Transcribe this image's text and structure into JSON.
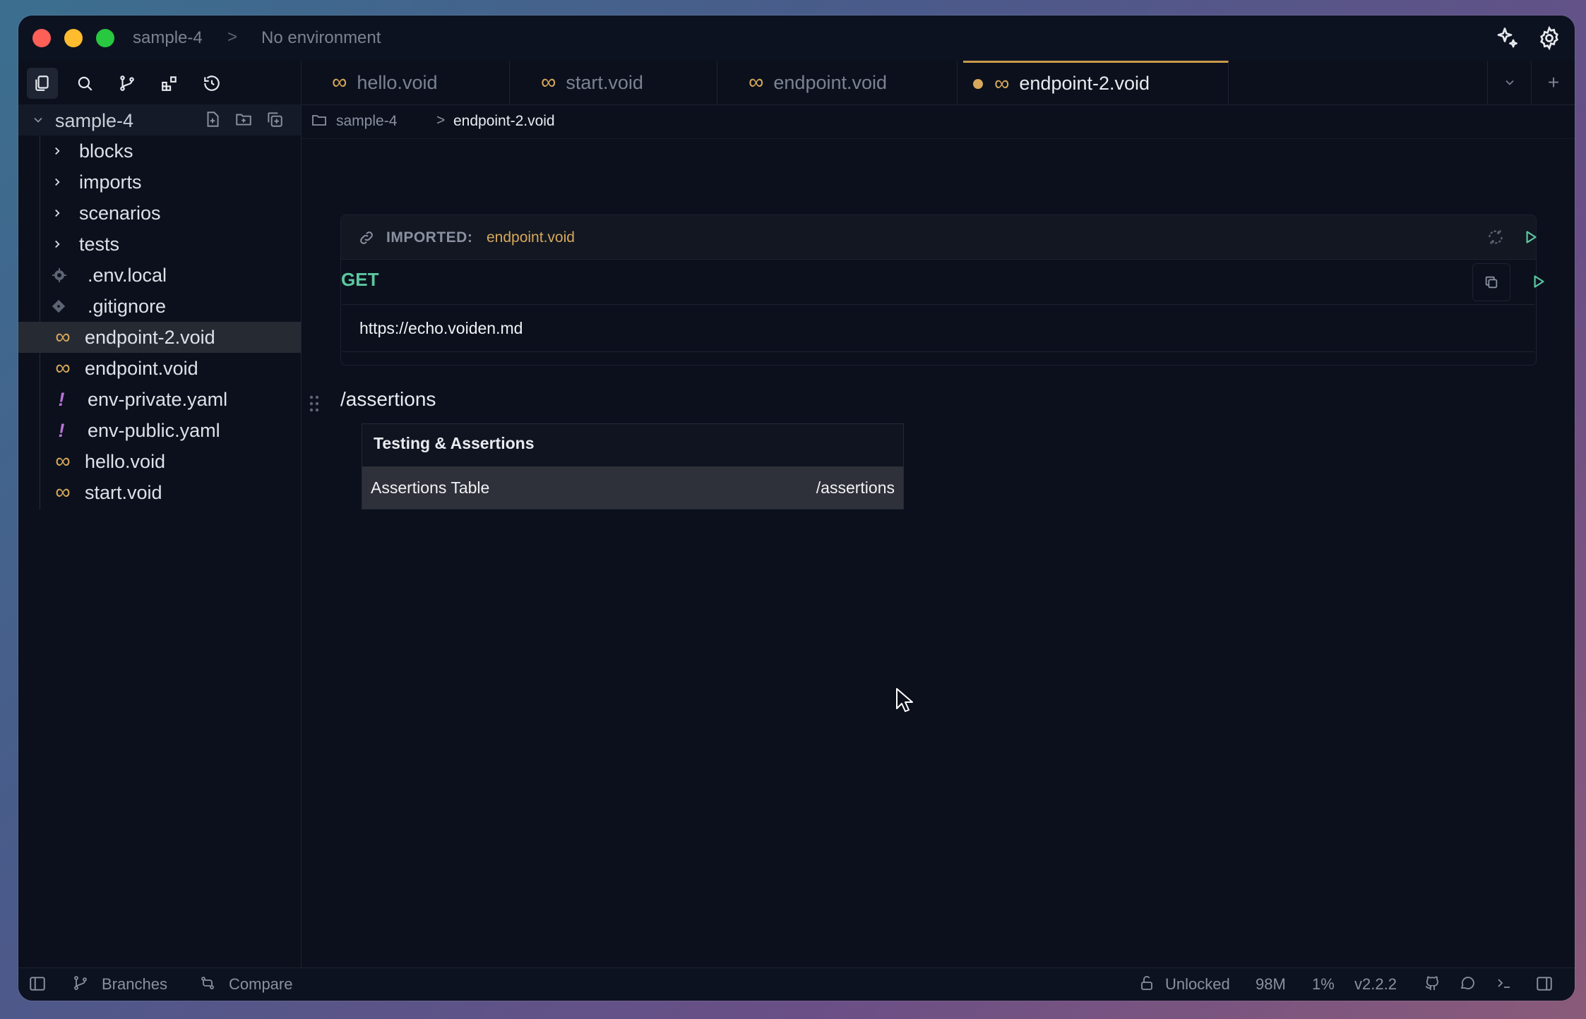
{
  "titlebar": {
    "project": "sample-4",
    "separator": ">",
    "environment": "No environment"
  },
  "tabs": [
    {
      "label": "hello.void",
      "icon": "infinity-icon",
      "active": false
    },
    {
      "label": "start.void",
      "icon": "infinity-icon",
      "active": false
    },
    {
      "label": "endpoint.void",
      "icon": "infinity-icon",
      "active": false
    },
    {
      "label": "endpoint-2.void",
      "icon": "infinity-icon",
      "active": true,
      "modified": true
    }
  ],
  "tab_controls": {
    "dropdown": "⌄",
    "add": "+"
  },
  "sidebar": {
    "project_name": "sample-4",
    "items": [
      {
        "label": "blocks",
        "type": "folder"
      },
      {
        "label": "imports",
        "type": "folder"
      },
      {
        "label": "scenarios",
        "type": "folder"
      },
      {
        "label": "tests",
        "type": "folder"
      },
      {
        "label": ".env.local",
        "type": "gear"
      },
      {
        "label": ".gitignore",
        "type": "git"
      },
      {
        "label": "endpoint-2.void",
        "type": "void",
        "selected": true
      },
      {
        "label": "endpoint.void",
        "type": "void"
      },
      {
        "label": "env-private.yaml",
        "type": "yaml"
      },
      {
        "label": "env-public.yaml",
        "type": "yaml"
      },
      {
        "label": "hello.void",
        "type": "void"
      },
      {
        "label": "start.void",
        "type": "void"
      }
    ]
  },
  "breadcrumb": {
    "folder": "sample-4",
    "sep": ">",
    "file": "endpoint-2.void"
  },
  "editor": {
    "imported_label": "IMPORTED:",
    "imported_file": "endpoint.void",
    "method": "GET",
    "url": "https://echo.voiden.md",
    "command": "/assertions",
    "menu": {
      "header": "Testing & Assertions",
      "items": [
        {
          "label": "Assertions Table",
          "shortcut": "/assertions"
        }
      ]
    }
  },
  "statusbar": {
    "branches": "Branches",
    "compare": "Compare",
    "lock": "Unlocked",
    "memory": "98M",
    "cpu": "1%",
    "version": "v2.2.2"
  },
  "colors": {
    "accent": "#d7a85a",
    "method_get": "#5cc8a0",
    "background": "#0b101c"
  }
}
